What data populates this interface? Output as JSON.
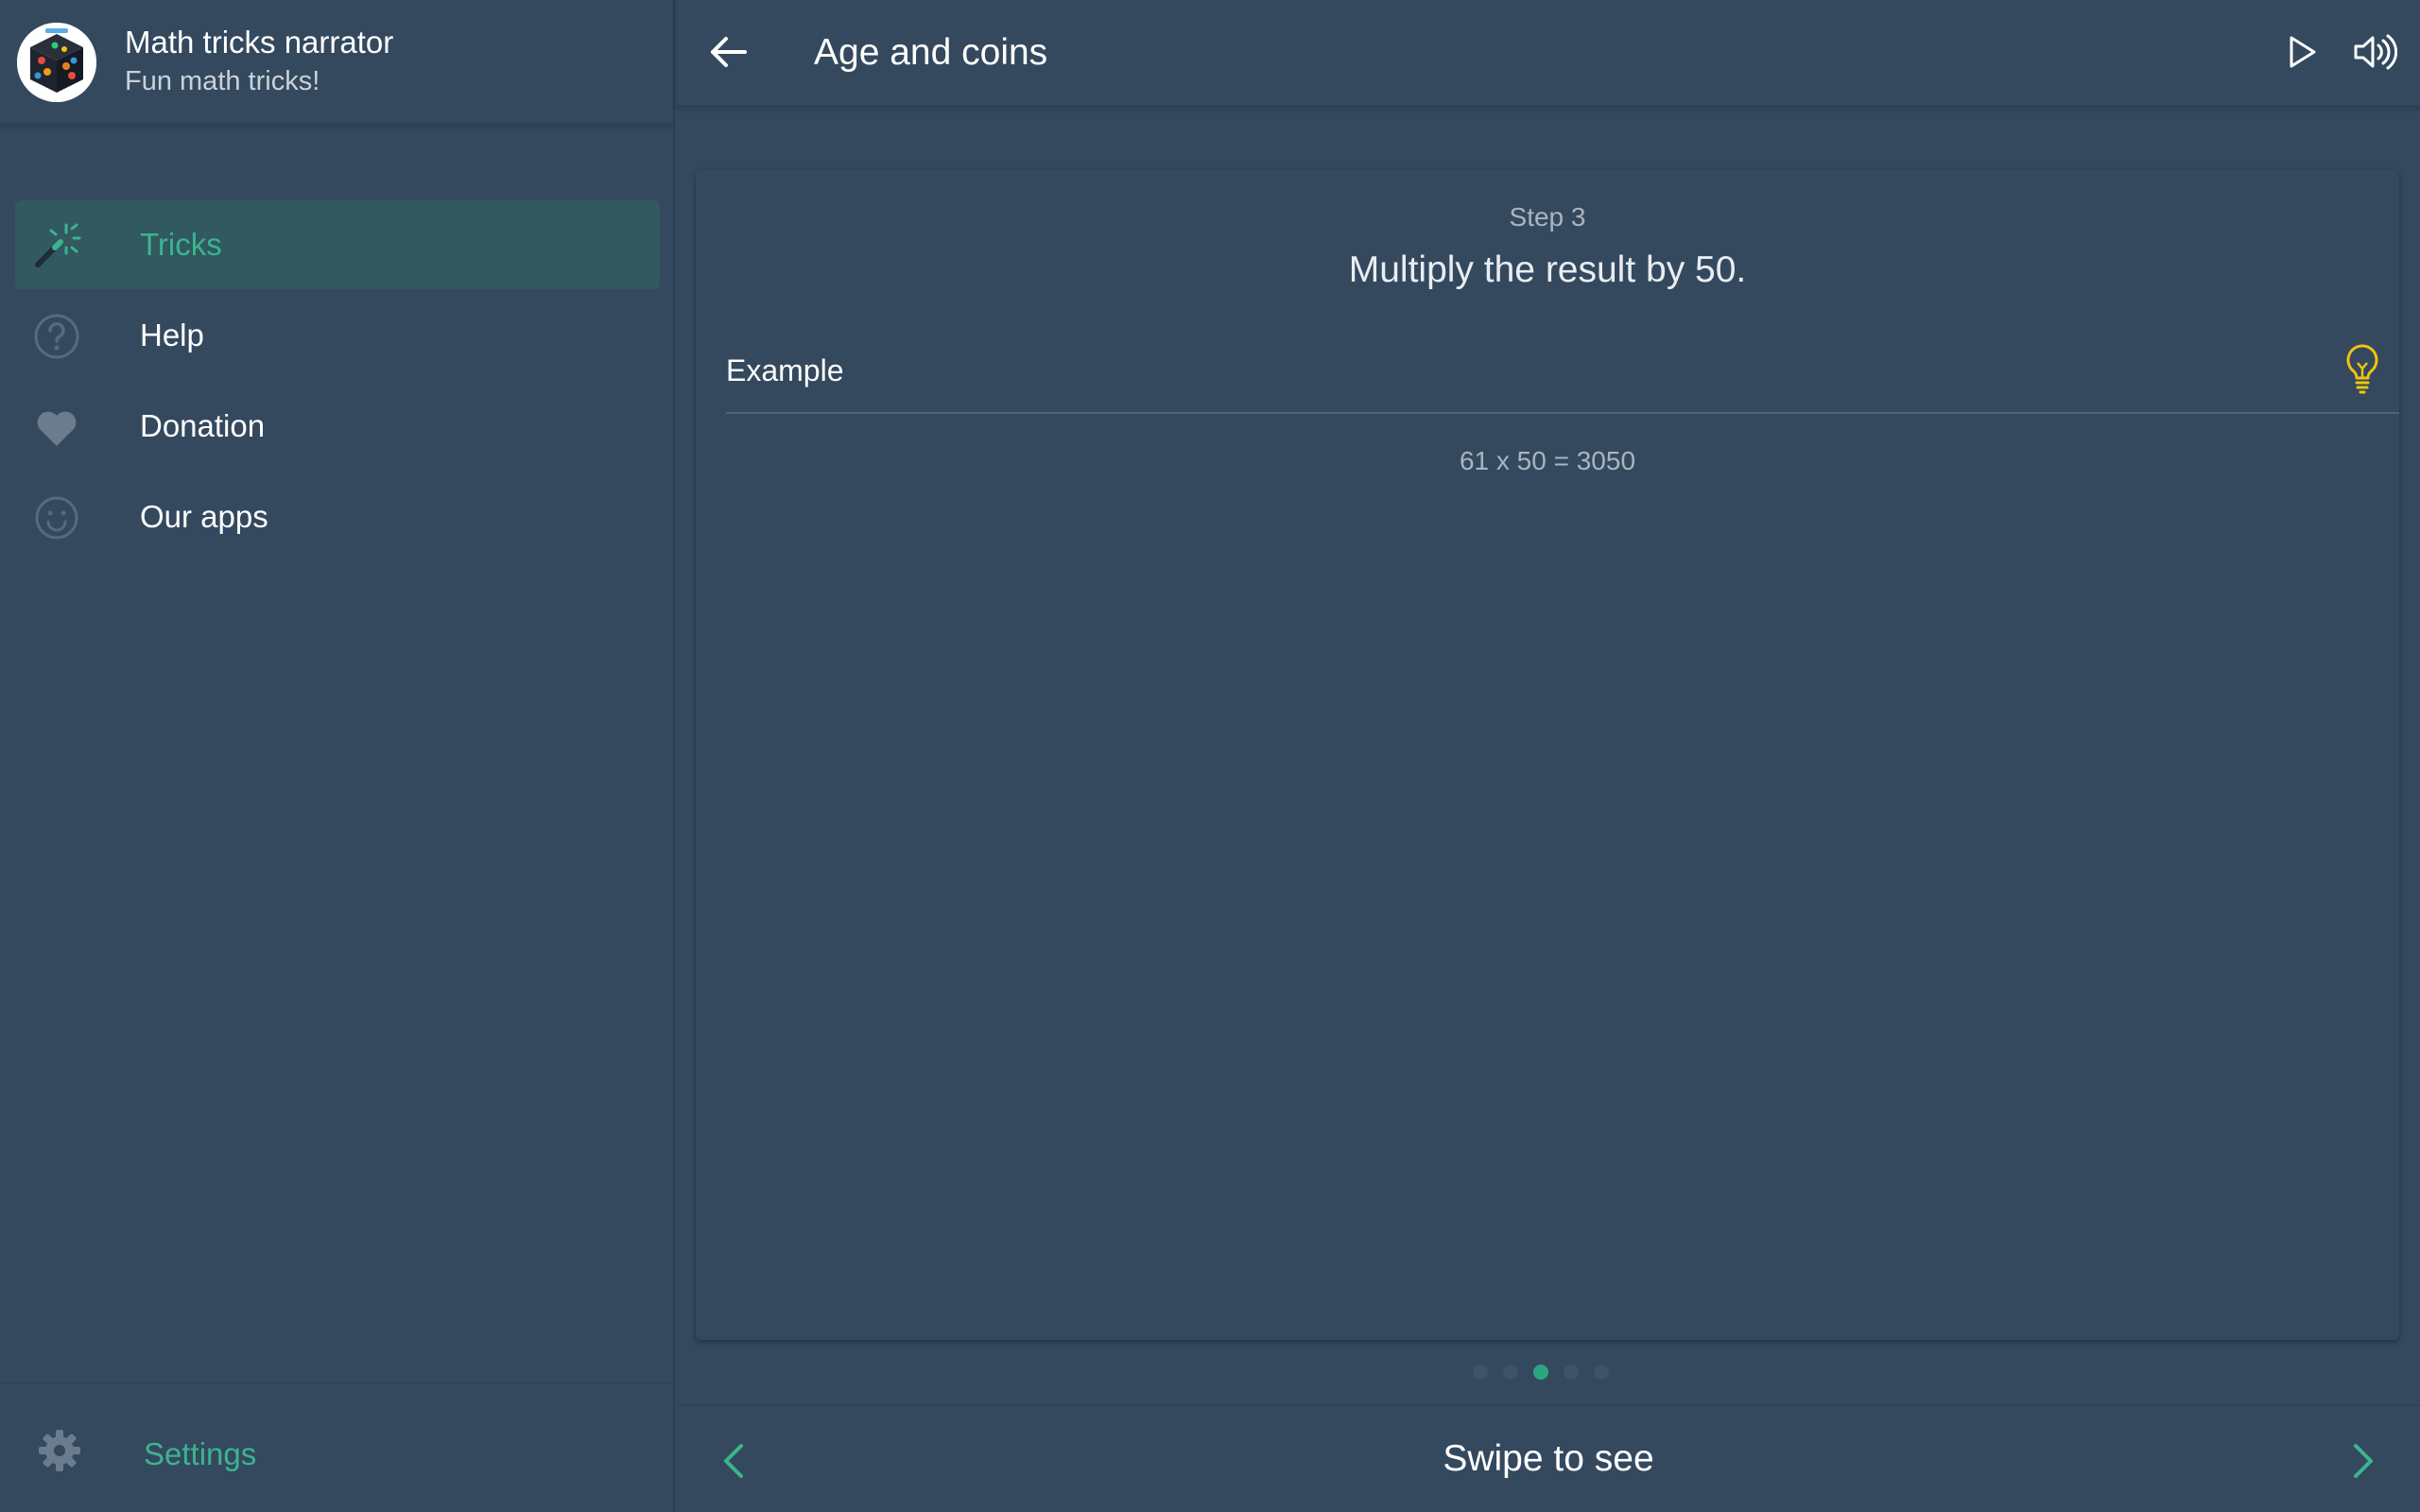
{
  "sidebar": {
    "app_title": "Math tricks narrator",
    "app_subtitle": "Fun math tricks!",
    "items": [
      {
        "label": "Tricks",
        "icon": "magic-wand-icon",
        "active": true
      },
      {
        "label": "Help",
        "icon": "question-icon",
        "active": false
      },
      {
        "label": "Donation",
        "icon": "heart-icon",
        "active": false
      },
      {
        "label": "Our apps",
        "icon": "smiley-icon",
        "active": false
      }
    ],
    "settings_label": "Settings"
  },
  "topbar": {
    "title": "Age and coins",
    "back_icon": "arrow-left-icon",
    "play_icon": "play-icon",
    "sound_icon": "volume-icon"
  },
  "card": {
    "step_label": "Step 3",
    "step_text": "Multiply the result by 50.",
    "example_label": "Example",
    "example_text": "61 x 50 = 3050",
    "hint_icon": "lightbulb-icon"
  },
  "pagination": {
    "total": 5,
    "current": 3
  },
  "bottombar": {
    "label": "Swipe to see",
    "prev_icon": "chevron-left-icon",
    "next_icon": "chevron-right-icon"
  },
  "colors": {
    "background": "#34495e",
    "accent": "#3bb48f",
    "active_item_bg": "#31595f",
    "hint": "#f1c40f"
  }
}
